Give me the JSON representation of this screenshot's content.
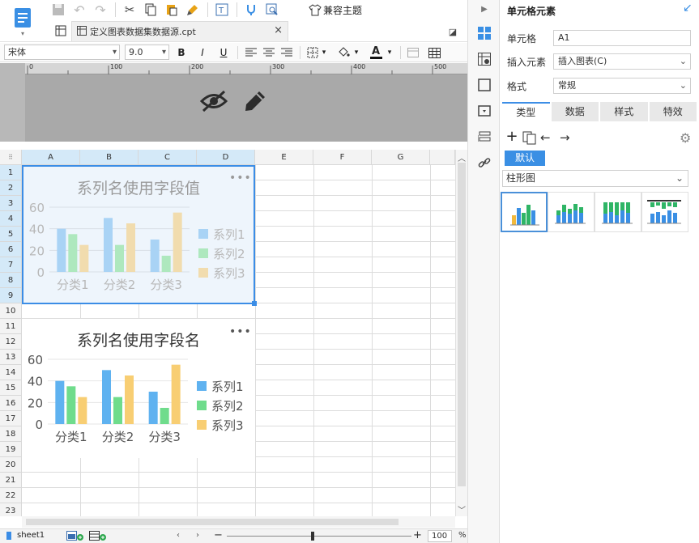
{
  "toolbar": {
    "theme_label": "兼容主题"
  },
  "tab": {
    "title": "定义图表数据集数据源.cpt"
  },
  "format": {
    "font_name": "宋体",
    "font_size": "9.0"
  },
  "ruler": {
    "ticks": [
      "0",
      "100",
      "200",
      "300",
      "400",
      "500"
    ]
  },
  "grid": {
    "columns": [
      "A",
      "B",
      "C",
      "D",
      "E",
      "F",
      "G"
    ],
    "rows": [
      "1",
      "2",
      "3",
      "4",
      "5",
      "6",
      "7",
      "8",
      "9",
      "10",
      "11",
      "12",
      "13",
      "14",
      "15",
      "16",
      "17",
      "18",
      "19",
      "20",
      "21",
      "22",
      "23"
    ]
  },
  "bottom": {
    "sheet": "sheet1",
    "zoom": "100",
    "zoom_unit": "%"
  },
  "panel": {
    "title": "单元格元素",
    "cell_label": "单元格",
    "cell_value": "A1",
    "insert_label": "插入元素",
    "insert_value": "插入图表(C)",
    "format_label": "格式",
    "format_value": "常规",
    "tabs": [
      "类型",
      "数据",
      "样式",
      "特效"
    ],
    "default_label": "默认",
    "chart_type": "柱形图"
  },
  "chart_data": [
    {
      "type": "bar",
      "title": "系列名使用字段值",
      "categories": [
        "分类1",
        "分类2",
        "分类3"
      ],
      "series": [
        {
          "name": "系列1",
          "values": [
            40,
            50,
            30
          ]
        },
        {
          "name": "系列2",
          "values": [
            35,
            25,
            15
          ]
        },
        {
          "name": "系列3",
          "values": [
            25,
            45,
            55
          ]
        }
      ],
      "yticks": [
        "0",
        "20",
        "40",
        "60"
      ],
      "ylim": [
        0,
        60
      ],
      "legend": "right",
      "colors": [
        "#a9d3f5",
        "#aee8be",
        "#f1dcae"
      ]
    },
    {
      "type": "bar",
      "title": "系列名使用字段名",
      "categories": [
        "分类1",
        "分类2",
        "分类3"
      ],
      "series": [
        {
          "name": "系列1",
          "values": [
            40,
            50,
            30
          ]
        },
        {
          "name": "系列2",
          "values": [
            35,
            25,
            15
          ]
        },
        {
          "name": "系列3",
          "values": [
            25,
            45,
            55
          ]
        }
      ],
      "yticks": [
        "0",
        "20",
        "40",
        "60"
      ],
      "ylim": [
        0,
        60
      ],
      "legend": "right",
      "colors": [
        "#5fb2f0",
        "#6fdc8c",
        "#f8ce73"
      ]
    }
  ]
}
